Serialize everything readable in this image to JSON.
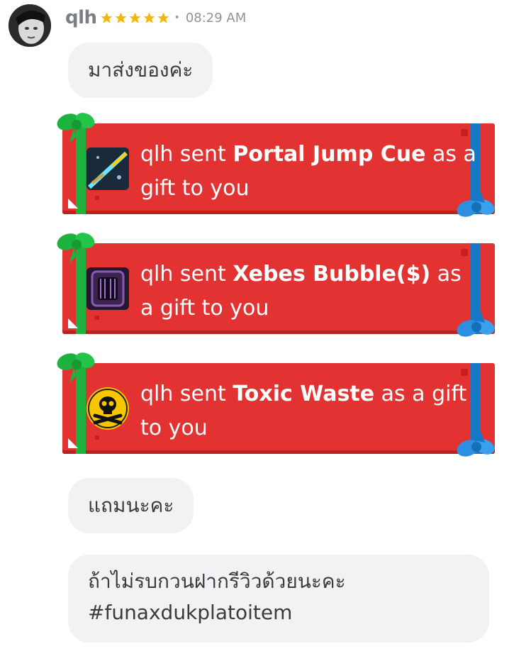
{
  "message": {
    "username": "qlh",
    "rating_stars": 5,
    "time": "08:29 AM"
  },
  "bubbles": {
    "first": "มาส่งของค่ะ",
    "second": "แถมนะคะ",
    "third_line1": "ถ้าไม่รบกวนฝากรีวิวด้วยนะคะ",
    "third_line2": "#funaxdukplatoitem"
  },
  "gifts": [
    {
      "prefix": "qlh sent ",
      "item": "Portal Jump Cue",
      "suffix": " as a gift to you",
      "icon": "cue-icon"
    },
    {
      "prefix": "qlh sent ",
      "item": "Xebes Bubble($)",
      "suffix": " as a gift to you",
      "icon": "bubble-frame-icon"
    },
    {
      "prefix": "qlh sent ",
      "item": "Toxic Waste",
      "suffix": " as a gift to you",
      "icon": "skull-crossbones-icon"
    }
  ],
  "colors": {
    "gift_red": "#e23232",
    "ribbon_green": "#1db23d",
    "ribbon_blue": "#1878c8",
    "star_gold": "#f5b800",
    "bubble_bg": "#f1f2f4"
  }
}
